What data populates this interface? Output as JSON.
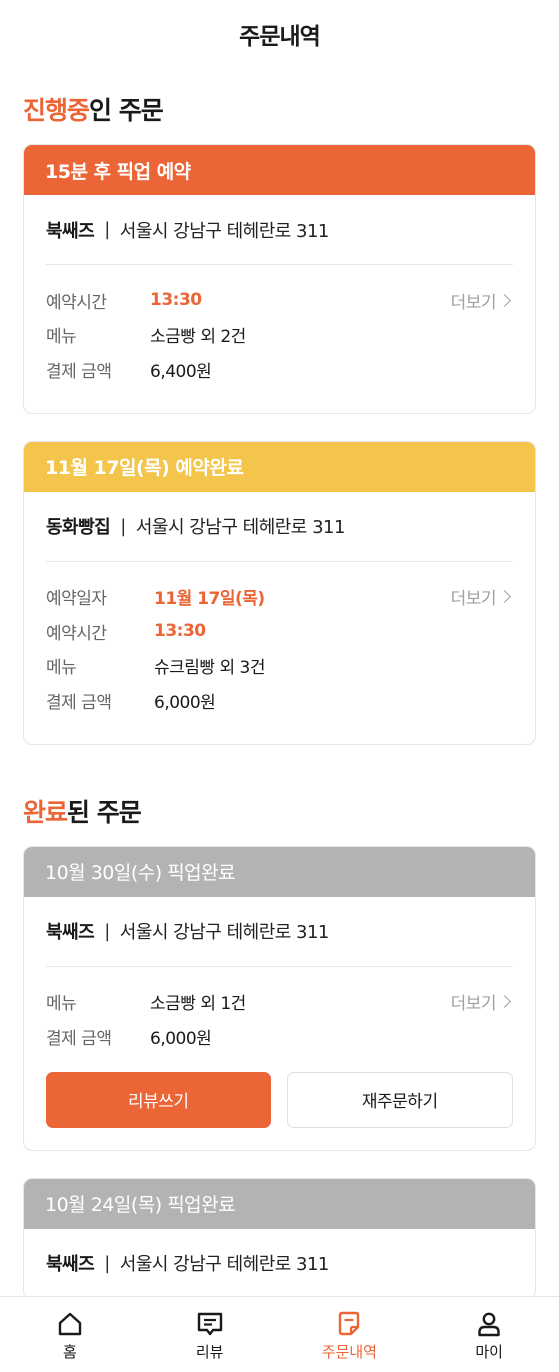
{
  "header": {
    "title": "주문내역"
  },
  "in_progress": {
    "title_accent": "진행중",
    "title_rest": "인 주문",
    "orders": [
      {
        "head": "15분 후 픽업 예약",
        "store": "북쌔즈",
        "separator": "|",
        "address": "서울시 강남구 테헤란로 311",
        "more": "더보기",
        "rows": [
          {
            "label": "예약시간",
            "value": "13:30"
          },
          {
            "label": "메뉴",
            "value": "소금빵 외 2건"
          },
          {
            "label": "결제 금액",
            "value": "6,400원"
          }
        ]
      },
      {
        "head": "11월 17일(목) 예약완료",
        "store": "동화빵집",
        "separator": "|",
        "address": "서울시 강남구 테헤란로 311",
        "more": "더보기",
        "rows": [
          {
            "label": "예약일자",
            "value": "11월 17일(목)"
          },
          {
            "label": "예약시간",
            "value": "13:30"
          },
          {
            "label": "메뉴",
            "value": "슈크림빵 외 3건"
          },
          {
            "label": "결제 금액",
            "value": "6,000원"
          }
        ]
      }
    ]
  },
  "completed": {
    "title_accent": "완료",
    "title_rest": "된 주문",
    "orders": [
      {
        "head": "10월 30일(수) 픽업완료",
        "store": "북쌔즈",
        "separator": "|",
        "address": "서울시 강남구 테헤란로 311",
        "more": "더보기",
        "rows": [
          {
            "label": "메뉴",
            "value": "소금빵 외 1건"
          },
          {
            "label": "결제 금액",
            "value": "6,000원"
          }
        ],
        "review_button": "리뷰쓰기",
        "reorder_button": "재주문하기"
      },
      {
        "head": "10월 24일(목) 픽업완료",
        "store": "북쌔즈",
        "separator": "|",
        "address": "서울시 강남구 테헤란로 311"
      }
    ]
  },
  "tabbar": {
    "items": [
      {
        "label": "홈",
        "icon": "home-icon"
      },
      {
        "label": "리뷰",
        "icon": "review-icon"
      },
      {
        "label": "주문내역",
        "icon": "order-history-icon",
        "active": true
      },
      {
        "label": "마이",
        "icon": "person-icon"
      }
    ]
  },
  "colors": {
    "accent": "#ec6537",
    "reserved": "#f3c54a",
    "completed": "#b3b3b3"
  }
}
